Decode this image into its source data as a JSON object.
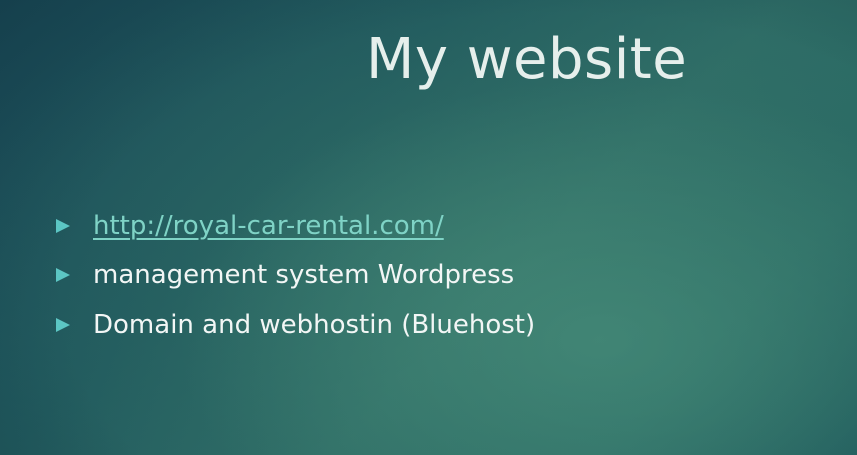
{
  "slide": {
    "title": "My website",
    "bullets": [
      {
        "text": "http://royal-car-rental.com/",
        "is_link": true
      },
      {
        "text": "management system Wordpress",
        "is_link": false
      },
      {
        "text": "Domain and webhostin (Bluehost)",
        "is_link": false
      }
    ]
  },
  "colors": {
    "background": "#245e60",
    "title": "#e6efec",
    "bullet_marker": "#5cc6c4",
    "link": "#7fd3c6",
    "text": "#f2f6f5"
  },
  "icons": {
    "bullet": "triangle-right-icon"
  }
}
